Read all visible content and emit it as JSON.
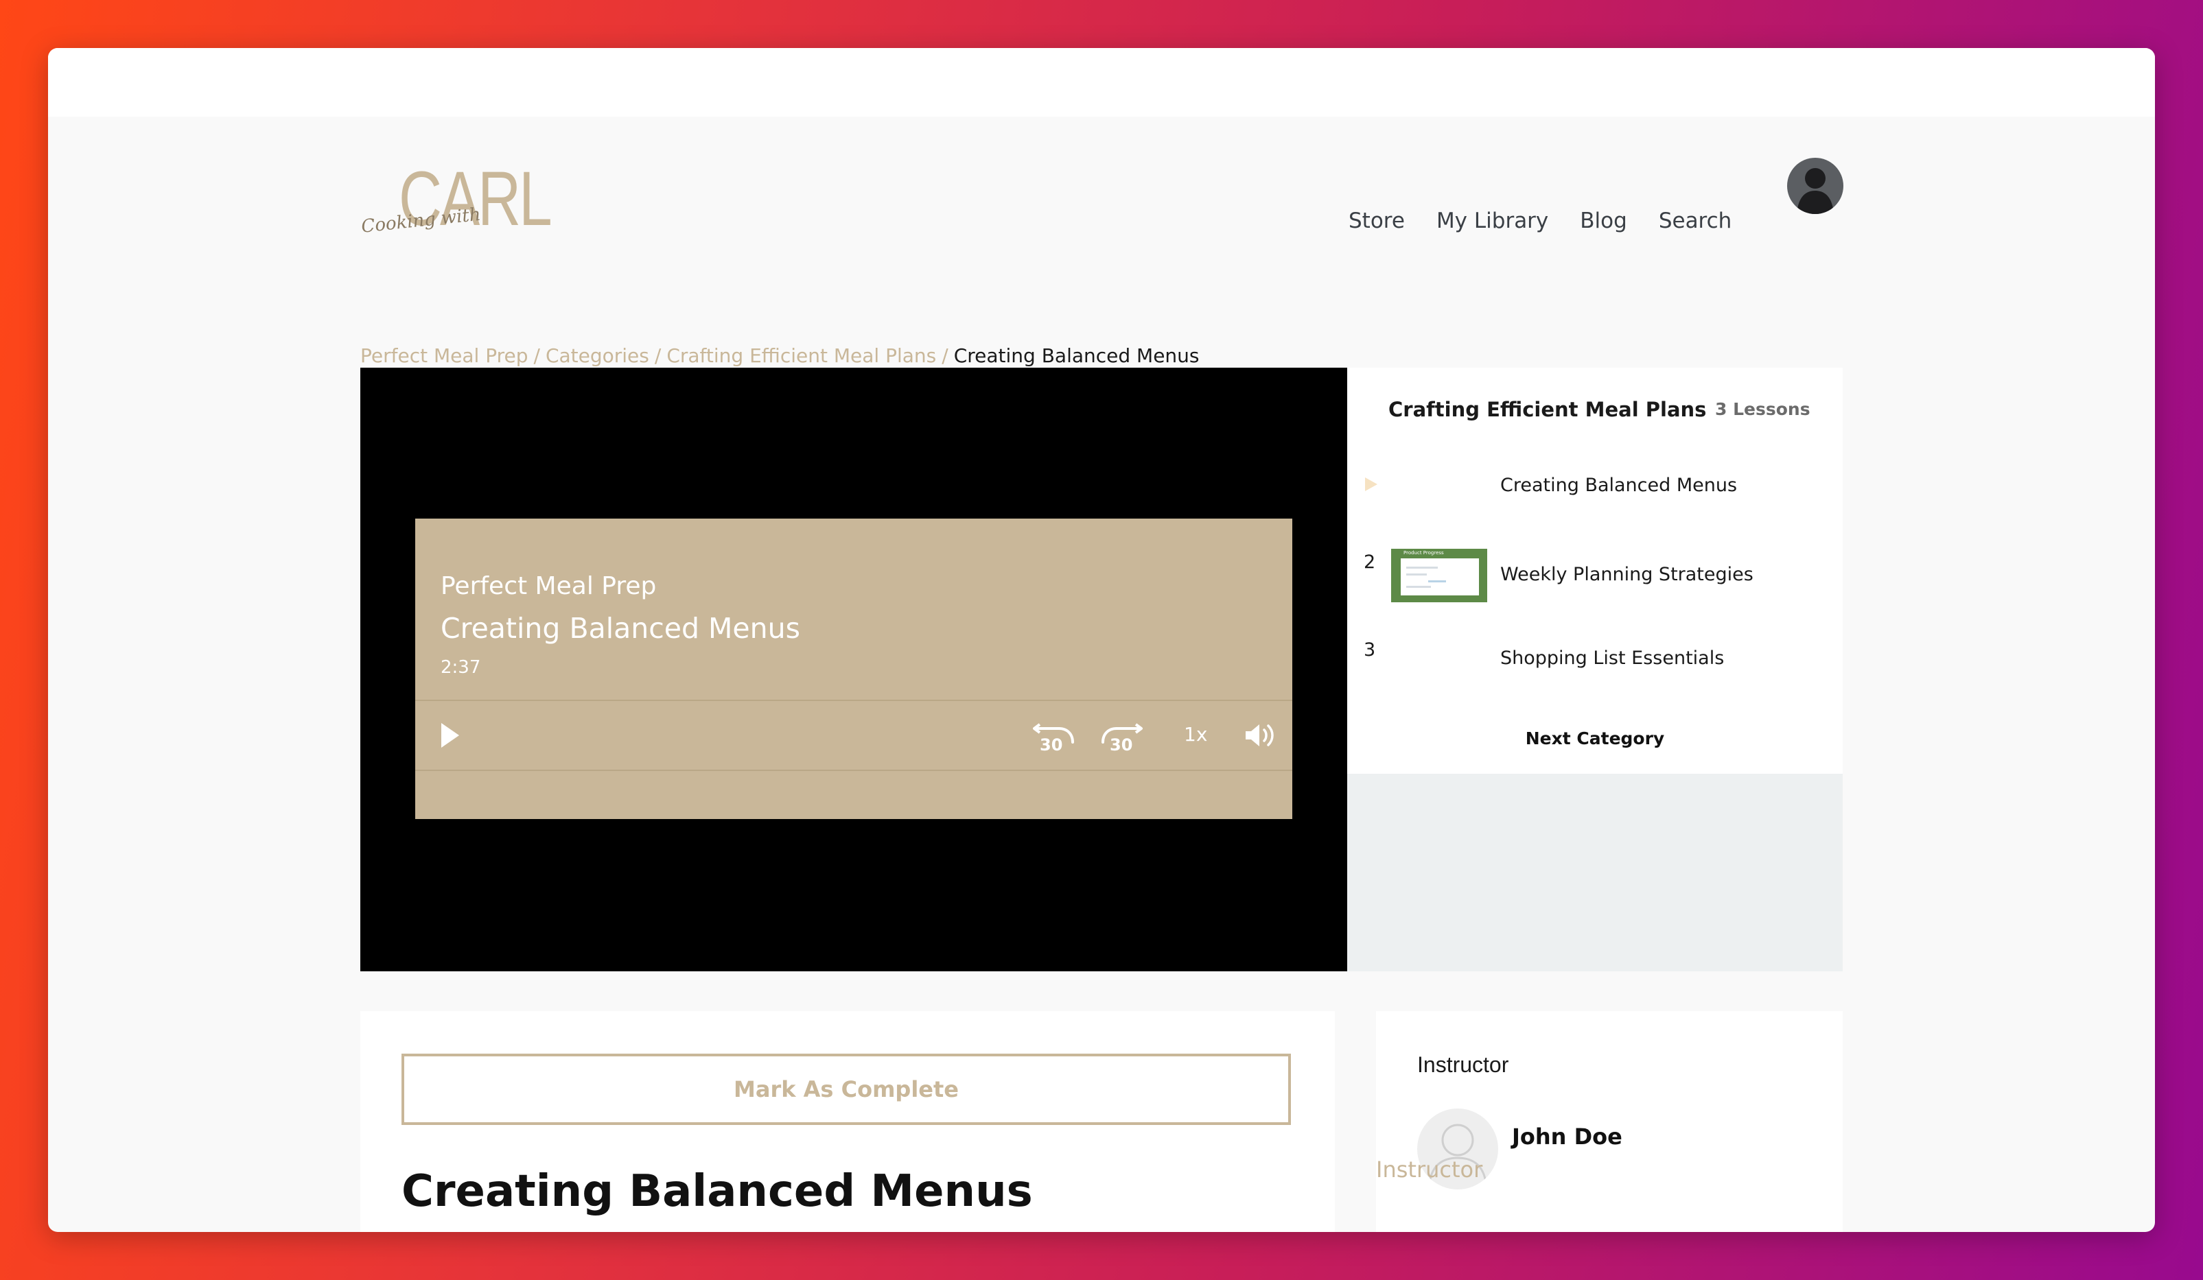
{
  "logo": {
    "script": "Cooking with",
    "name": "CARL"
  },
  "nav": {
    "items": [
      "Store",
      "My Library",
      "Blog",
      "Search"
    ]
  },
  "breadcrumb": {
    "items": [
      "Perfect Meal Prep",
      "Categories",
      "Crafting Efficient Meal Plans"
    ],
    "current": "Creating Balanced Menus",
    "separator": "/"
  },
  "player": {
    "course": "Perfect Meal Prep",
    "title": "Creating Balanced Menus",
    "duration": "2:37",
    "rewind_seconds": "30",
    "forward_seconds": "30",
    "speed": "1x",
    "icons": [
      "play-icon",
      "rewind-30-icon",
      "forward-30-icon",
      "volume-icon"
    ],
    "background_color": "#c9b799"
  },
  "lessons_panel": {
    "title": "Crafting Efficient Meal Plans",
    "count": "3 Lessons",
    "lessons": [
      {
        "number": "",
        "name": "Creating Balanced Menus",
        "current": true
      },
      {
        "number": "2",
        "name": "Weekly Planning Strategies",
        "thumbnail_text": "Product Progress"
      },
      {
        "number": "3",
        "name": "Shopping List Essentials"
      }
    ],
    "next_label": "Next Category"
  },
  "main": {
    "complete_label": "Mark As Complete",
    "lesson_title": "Creating Balanced Menus"
  },
  "instructor": {
    "label": "Instructor",
    "name": "John Doe",
    "role": "Instructor"
  },
  "colors": {
    "accent": "#c9b799",
    "text": "#1a1a1a"
  }
}
